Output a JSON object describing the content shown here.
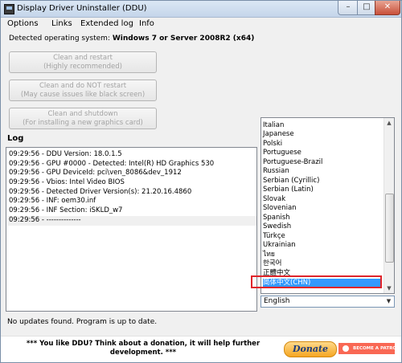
{
  "window": {
    "title": "Display Driver Uninstaller (DDU)",
    "caption_buttons": {
      "minimize": "–",
      "maximize": "□",
      "close": "✕"
    }
  },
  "menu": [
    "Options",
    "Links",
    "Extended log",
    "Info"
  ],
  "detected": {
    "prefix": "Detected operating system:",
    "os": "Windows 7 or Server 2008R2 (x64)"
  },
  "actions": [
    {
      "line1": "Clean and restart",
      "line2": "(Highly recommended)"
    },
    {
      "line1": "Clean and do NOT restart",
      "line2": "(May cause issues like black screen)"
    },
    {
      "line1": "Clean and shutdown",
      "line2": "(For installing a new graphics card)"
    }
  ],
  "log": {
    "label": "Log",
    "lines": [
      "09:29:56 - DDU Version: 18.0.1.5",
      "09:29:56 - GPU #0000 - Detected: Intel(R) HD Graphics 530",
      "09:29:56 - GPU DeviceId: pci\\ven_8086&dev_1912",
      "09:29:56 - Vbios: Intel Video BIOS",
      "09:29:56 - Detected Driver Version(s): 21.20.16.4860",
      "09:29:56 - INF: oem30.inf",
      "09:29:56 - INF Section: iSKLD_w7",
      "09:29:56 - --------------"
    ]
  },
  "languages": {
    "items": [
      "Italian",
      "Japanese",
      "Polski",
      "Portuguese",
      "Portuguese-Brazil",
      "Russian",
      "Serbian (Cyrillic)",
      "Serbian (Latin)",
      "Slovak",
      "Slovenian",
      "Spanish",
      "Swedish",
      "Türkçe",
      "Ukrainian",
      "ไทย",
      "한국어",
      "正體中文",
      "简体中文(CHN)"
    ],
    "selected": "简体中文(CHN)",
    "scrollbar": {
      "up": "▲",
      "down": "▼"
    },
    "combo_value": "English",
    "combo_arrow": "▼"
  },
  "status": "No updates found. Program is up to date.",
  "footer": {
    "message": "*** You like DDU? Think about a donation, it will help further development. ***",
    "donate_label": "Donate",
    "patron_label": "BECOME A PATRON"
  },
  "colors": {
    "selection": "#3399ff",
    "highlight_box": "#e0242a",
    "donate": "#f5a623",
    "patreon": "#f96854"
  }
}
